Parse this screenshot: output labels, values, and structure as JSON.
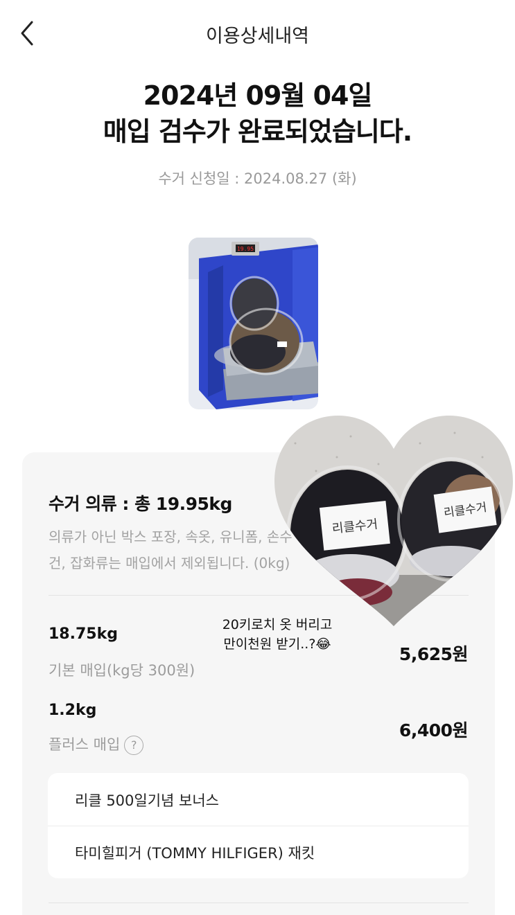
{
  "header": {
    "title": "이용상세내역"
  },
  "headline": {
    "line1": "2024년 09월 04일",
    "line2": "매입 검수가 완료되었습니다."
  },
  "request_date": "수거 신청일 : 2024.08.27 (화)",
  "scale_display": "19.95",
  "summary": {
    "title": "수거 의류 : 총 19.95kg",
    "note": "의류가 아닌 박스 포장, 속옷, 유니폼, 손수건, 잡화류는 매입에서 제외됩니다. (0kg)"
  },
  "basic": {
    "weight": "18.75kg",
    "label": "기본 매입(kg당 300원)",
    "amount": "5,625원"
  },
  "plus": {
    "weight": "1.2kg",
    "label": "플러스 매입",
    "help": "?",
    "amount": "6,400원",
    "items": [
      "리클 500일기념 보너스",
      "타미힐피거 (TOMMY HILFIGER) 재킷"
    ]
  },
  "sticker": {
    "bag_label_left": "리클수거",
    "bag_label_right": "리클수거",
    "caption_line1": "20키로치 옷 버리고",
    "caption_line2": "만이천원 받기..?😂"
  }
}
